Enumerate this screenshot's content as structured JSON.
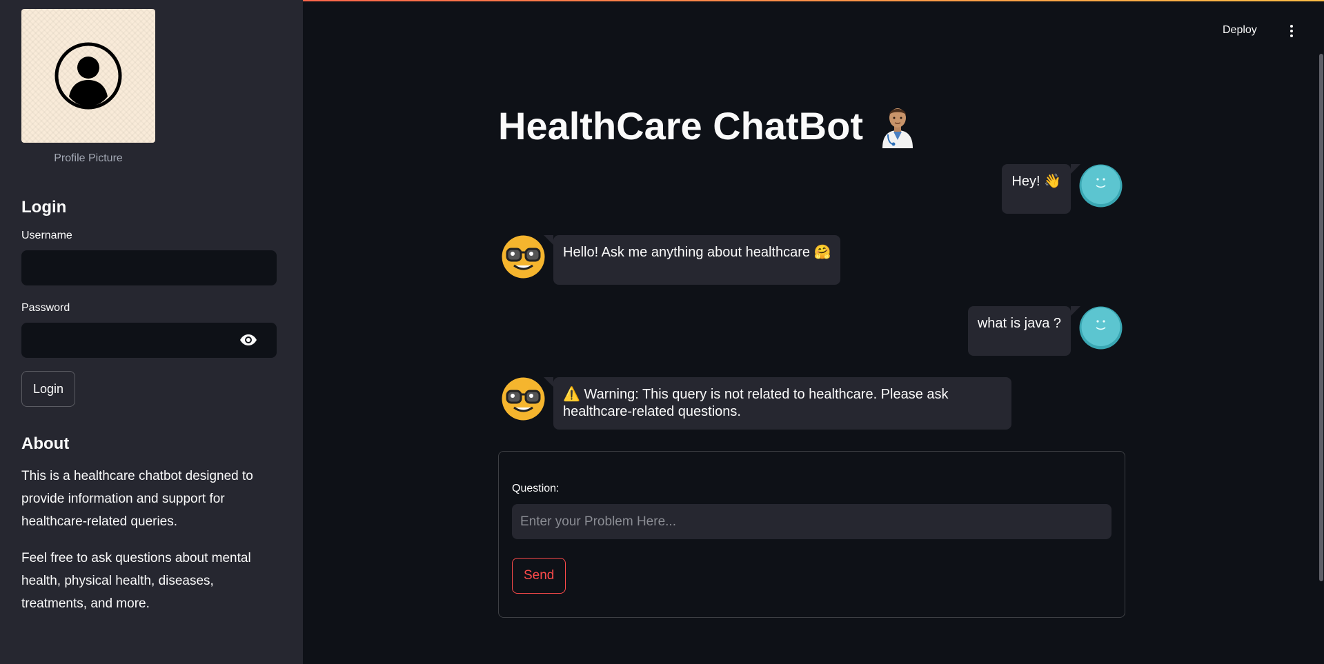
{
  "sidebar": {
    "profile_caption": "Profile Picture",
    "login_heading": "Login",
    "username_label": "Username",
    "username_value": "",
    "password_label": "Password",
    "password_value": "",
    "login_button": "Login",
    "about_heading": "About",
    "about_paragraphs": [
      "This is a healthcare chatbot designed to provide information and support for healthcare-related queries.",
      "Feel free to ask questions about mental health, physical health, diseases, treatments, and more."
    ]
  },
  "header": {
    "deploy_label": "Deploy",
    "menu_icon": "kebab-menu-icon"
  },
  "main": {
    "title": "HealthCare ChatBot",
    "title_icon": "doctor-emoji-icon",
    "messages": [
      {
        "role": "user",
        "text": "Hey! 👋",
        "avatar": "smiley-avatar-icon"
      },
      {
        "role": "bot",
        "text": "Hello! Ask me anything about healthcare 🤗",
        "avatar": "nerd-face-avatar-icon"
      },
      {
        "role": "user",
        "text": "what is java ?",
        "avatar": "smiley-avatar-icon"
      },
      {
        "role": "bot",
        "text": "⚠️ Warning: This query is not related to healthcare. Please ask healthcare-related questions.",
        "avatar": "nerd-face-avatar-icon"
      }
    ],
    "form": {
      "question_label": "Question:",
      "question_placeholder": "Enter your Problem Here...",
      "question_value": "",
      "send_label": "Send"
    }
  },
  "colors": {
    "background": "#0e1117",
    "sidebar": "#262730",
    "accent": "#ff4b4b",
    "user_avatar": "#4fc1cc",
    "bot_avatar": "#f5b52e"
  }
}
